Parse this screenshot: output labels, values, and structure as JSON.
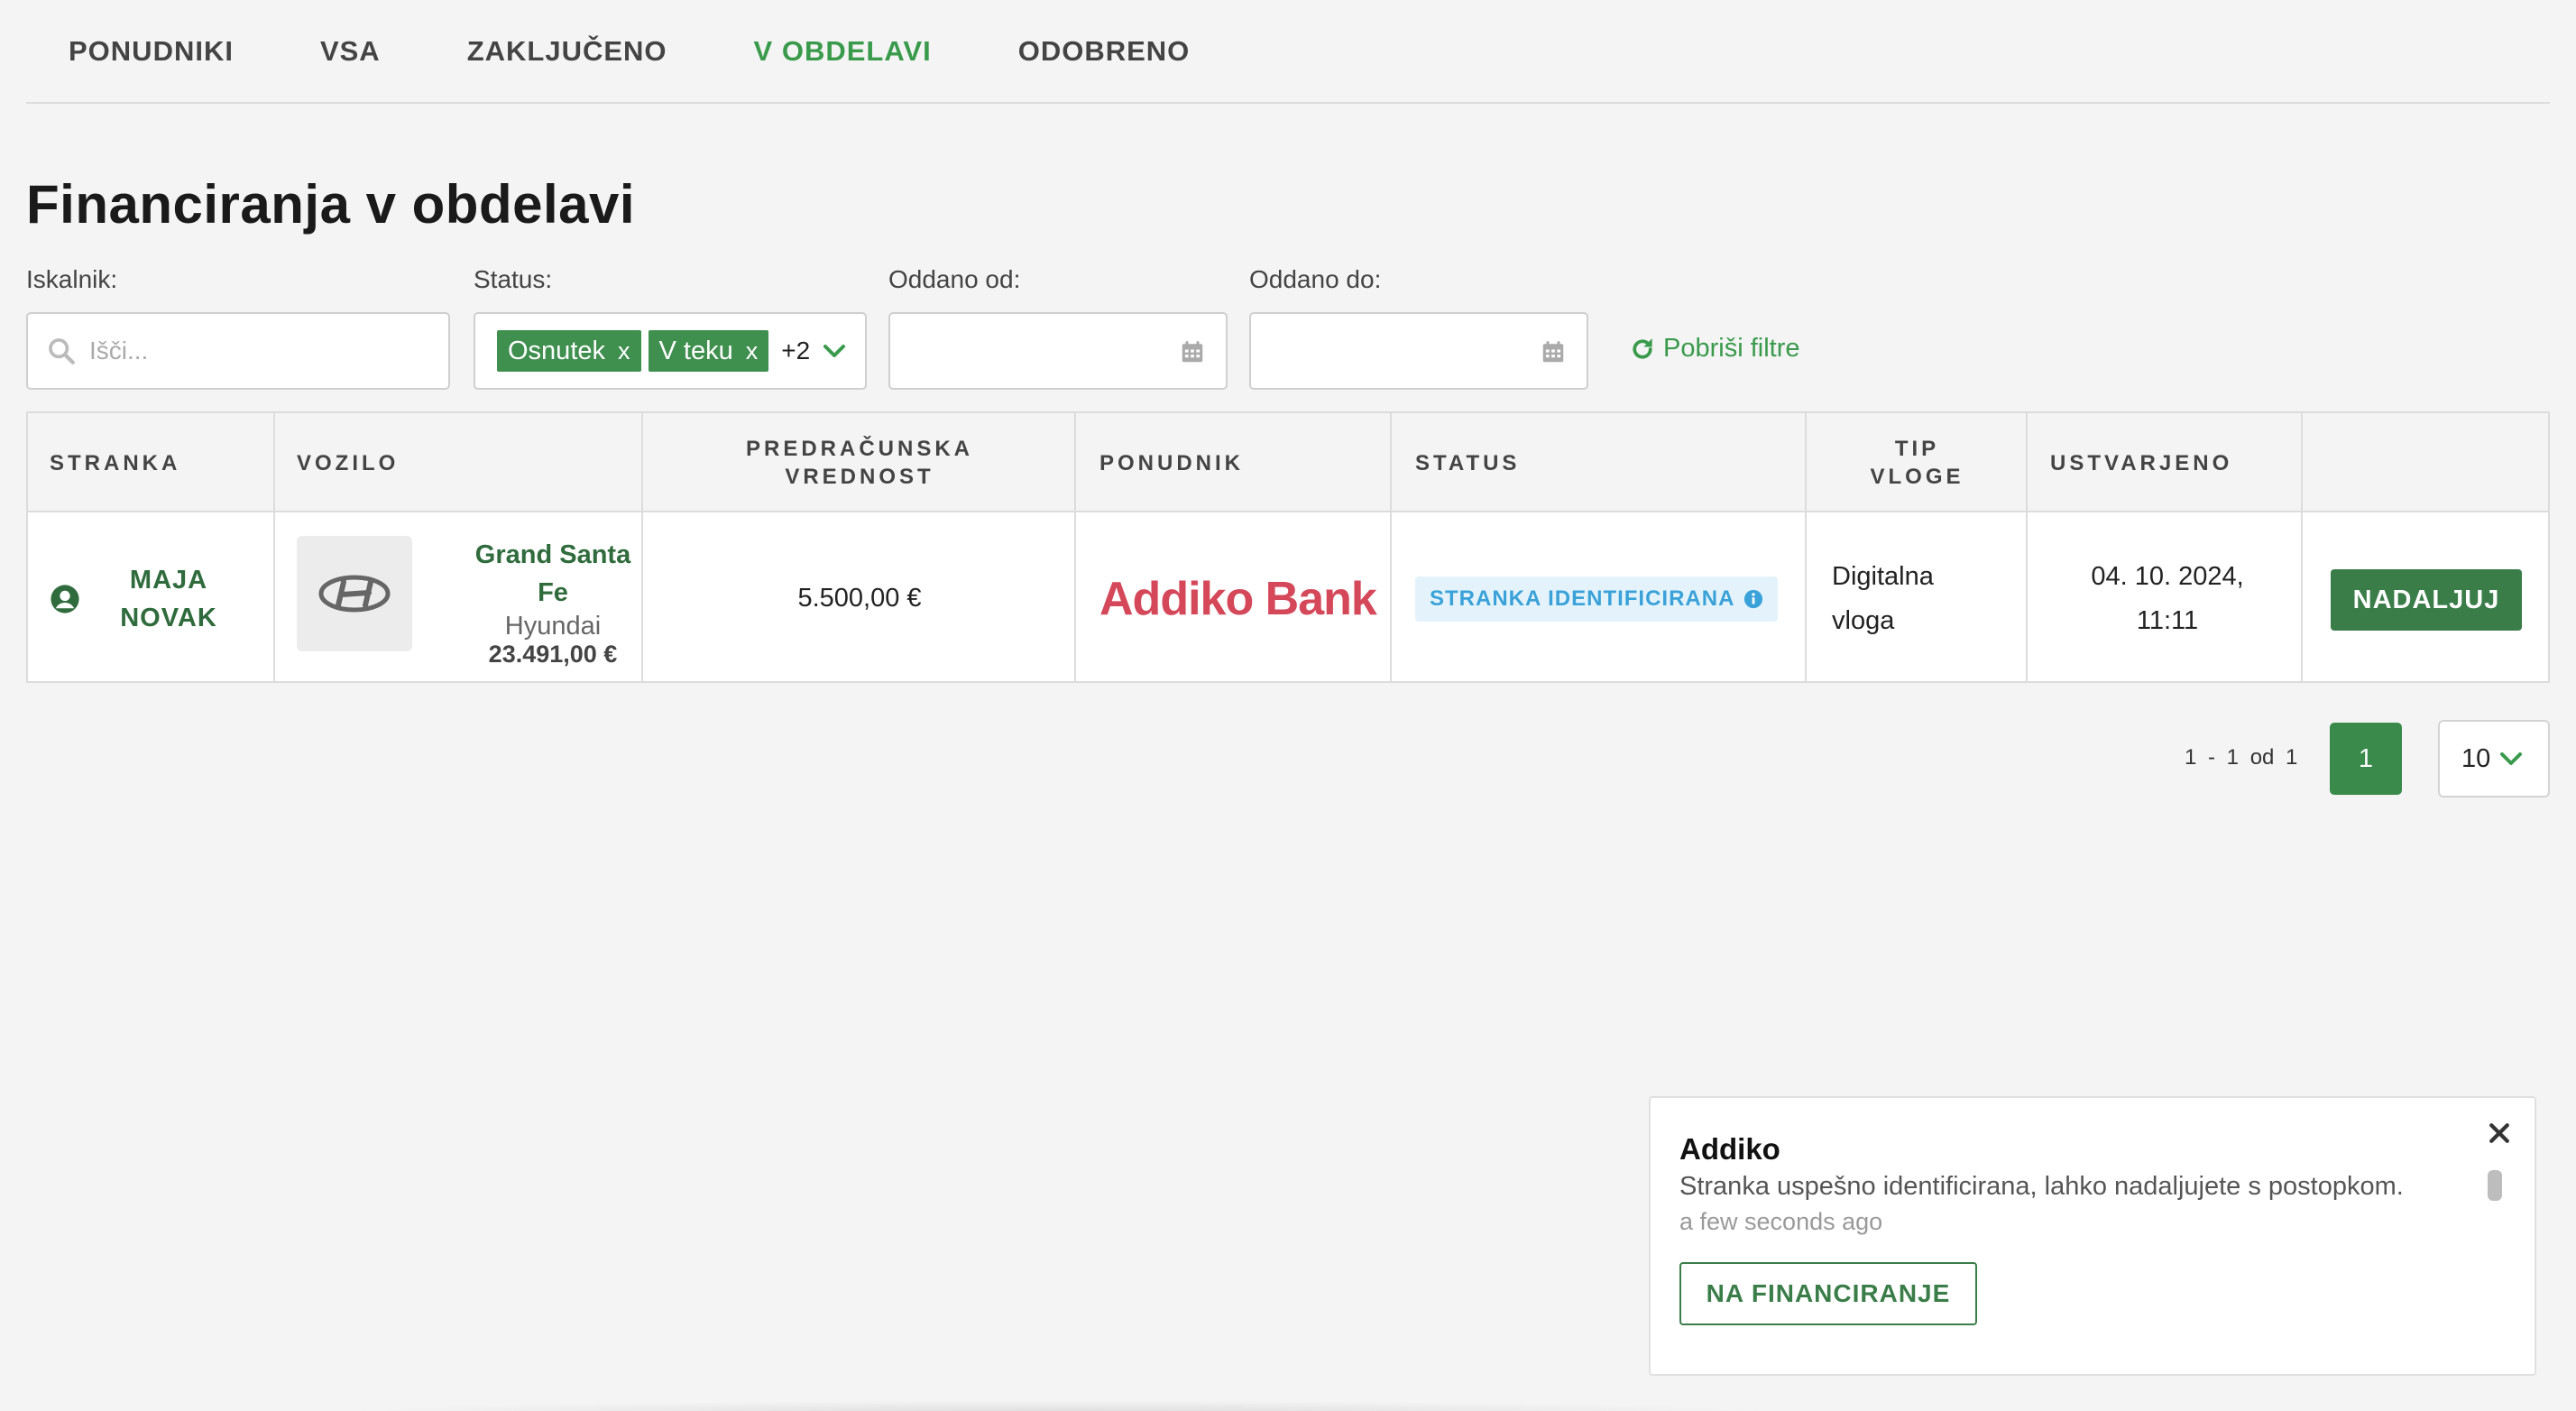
{
  "tabs": [
    {
      "label": "PONUDNIKI",
      "active": false
    },
    {
      "label": "VSA",
      "active": false
    },
    {
      "label": "ZAKLJUČENO",
      "active": false
    },
    {
      "label": "V OBDELAVI",
      "active": true
    },
    {
      "label": "ODOBRENO",
      "active": false
    }
  ],
  "page": {
    "title": "Financiranja v obdelavi"
  },
  "filters": {
    "search": {
      "label": "Iskalnik:",
      "placeholder": "Išči...",
      "value": ""
    },
    "status": {
      "label": "Status:",
      "chips": [
        {
          "label": "Osnutek",
          "remove": "x"
        },
        {
          "label": "V teku",
          "remove": "x"
        }
      ],
      "more": "+2"
    },
    "from": {
      "label": "Oddano od:",
      "value": ""
    },
    "to": {
      "label": "Oddano do:",
      "value": ""
    },
    "clear_label": "Pobriši filtre"
  },
  "table": {
    "headers": {
      "client": "STRANKA",
      "vehicle": "VOZILO",
      "value": "PREDRAČUNSKA\nVREDNOST",
      "provider": "PONUDNIK",
      "status": "STATUS",
      "type": "TIP\nVLOGE",
      "created": "USTVARJENO"
    },
    "rows": [
      {
        "client": "MAJA\nNOVAK",
        "vehicle": {
          "model": "Grand Santa\nFe",
          "brand": "Hyundai",
          "price": "23.491,00 €"
        },
        "value": "5.500,00 €",
        "provider": "Addiko Bank",
        "status": "STRANKA IDENTIFICIRANA",
        "type": "Digitalna\nvloga",
        "created": "04. 10. 2024,\n11:11",
        "action": "NADALJUJ"
      }
    ]
  },
  "pagination": {
    "range": "1 - 1  od  1",
    "current_page": "1",
    "page_size": "10"
  },
  "toast": {
    "title": "Addiko",
    "message": "Stranka uspešno identificirana, lahko nadaljujete s postopkom.",
    "time": "a few seconds ago",
    "button": "NA FINANCIRANJE"
  },
  "colors": {
    "accent": "#3a9a4c",
    "button": "#3a7d49",
    "provider_logo": "#d4485a",
    "badge_text": "#3aa2d8",
    "badge_bg": "#e4f3fb"
  },
  "icons": {
    "search": "search-icon",
    "chevron": "chevron-down-icon",
    "calendar": "calendar-icon",
    "refresh": "refresh-icon",
    "user": "user-circle-icon",
    "brand": "hyundai-logo-icon",
    "info": "info-icon",
    "close": "close-icon"
  }
}
